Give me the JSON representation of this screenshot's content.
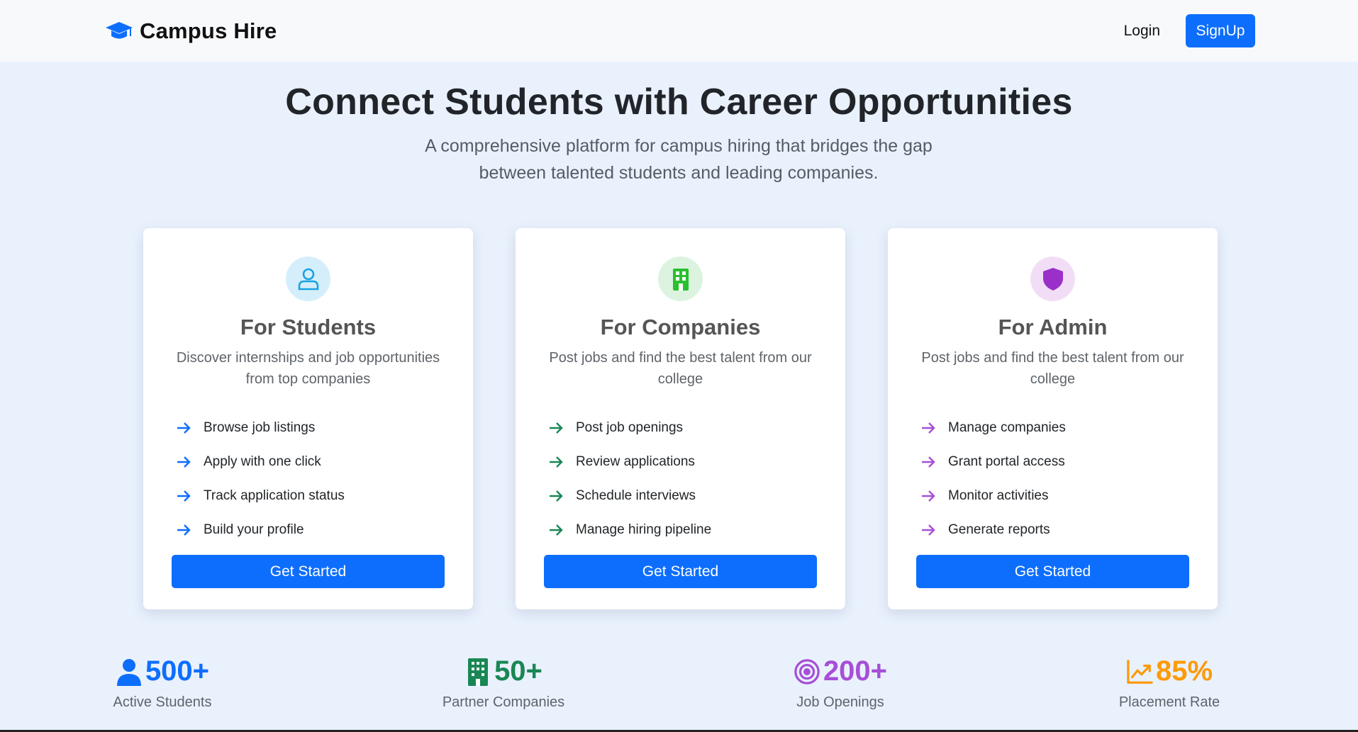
{
  "colors": {
    "primary": "#0d6efd",
    "students_accent": "#0d6efd",
    "companies_accent": "#198754",
    "admin_accent": "#a64fd7",
    "rate_accent": "#fd9a0a"
  },
  "navbar": {
    "brand": "Campus Hire",
    "brand_icon": "graduation-cap-icon",
    "login_label": "Login",
    "signup_label": "SignUp"
  },
  "hero": {
    "title": "Connect Students with Career Opportunities",
    "subtitle_line1": "A comprehensive platform for campus hiring that bridges the gap",
    "subtitle_line2": "between talented students and leading companies."
  },
  "cards": [
    {
      "icon": "user-icon",
      "title": "For Students",
      "desc_line1": "Discover internships and job opportunities",
      "desc_line2": "from top companies",
      "features": [
        "Browse job listings",
        "Apply with one click",
        "Track application status",
        "Build your profile"
      ],
      "button": "Get Started"
    },
    {
      "icon": "building-icon",
      "title": "For Companies",
      "desc_line1": "Post jobs and find the best talent from our",
      "desc_line2": "college",
      "features": [
        "Post job openings",
        "Review applications",
        "Schedule interviews",
        "Manage hiring pipeline"
      ],
      "button": "Get Started"
    },
    {
      "icon": "shield-icon",
      "title": "For Admin",
      "desc_line1": "Post jobs and find the best talent from our",
      "desc_line2": "college",
      "features": [
        "Manage companies",
        "Grant portal access",
        "Monitor activities",
        "Generate reports"
      ],
      "button": "Get Started"
    }
  ],
  "stats": [
    {
      "icon": "person-icon",
      "value": "500+",
      "label": "Active Students"
    },
    {
      "icon": "building-icon",
      "value": "50+",
      "label": "Partner Companies"
    },
    {
      "icon": "target-icon",
      "value": "200+",
      "label": "Job Openings"
    },
    {
      "icon": "trend-up-icon",
      "value": "85%",
      "label": "Placement Rate"
    }
  ]
}
